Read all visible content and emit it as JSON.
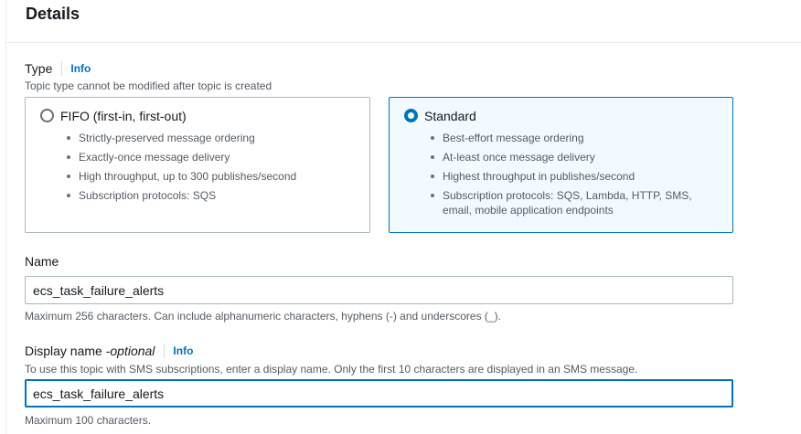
{
  "header": {
    "title": "Details"
  },
  "type": {
    "label": "Type",
    "info": "Info",
    "description": "Topic type cannot be modified after topic is created",
    "options": [
      {
        "title": "FIFO (first-in, first-out)",
        "selected": false,
        "bullets": [
          "Strictly-preserved message ordering",
          "Exactly-once message delivery",
          "High throughput, up to 300 publishes/second",
          "Subscription protocols: SQS"
        ]
      },
      {
        "title": "Standard",
        "selected": true,
        "bullets": [
          "Best-effort message ordering",
          "At-least once message delivery",
          "Highest throughput in publishes/second",
          "Subscription protocols: SQS, Lambda, HTTP, SMS, email, mobile application endpoints"
        ]
      }
    ]
  },
  "name": {
    "label": "Name",
    "value": "ecs_task_failure_alerts",
    "constraint": "Maximum 256 characters. Can include alphanumeric characters, hyphens (-) and underscores (_)."
  },
  "display_name": {
    "label": "Display name - ",
    "optional": "optional",
    "info": "Info",
    "description": "To use this topic with SMS subscriptions, enter a display name. Only the first 10 characters are displayed in an SMS message.",
    "value": "ecs_task_failure_alerts",
    "constraint": "Maximum 100 characters."
  },
  "colors": {
    "accent": "#0073bb",
    "selected_bg": "#f1faff",
    "border": "#aab7b8",
    "muted_text": "#545b64"
  }
}
